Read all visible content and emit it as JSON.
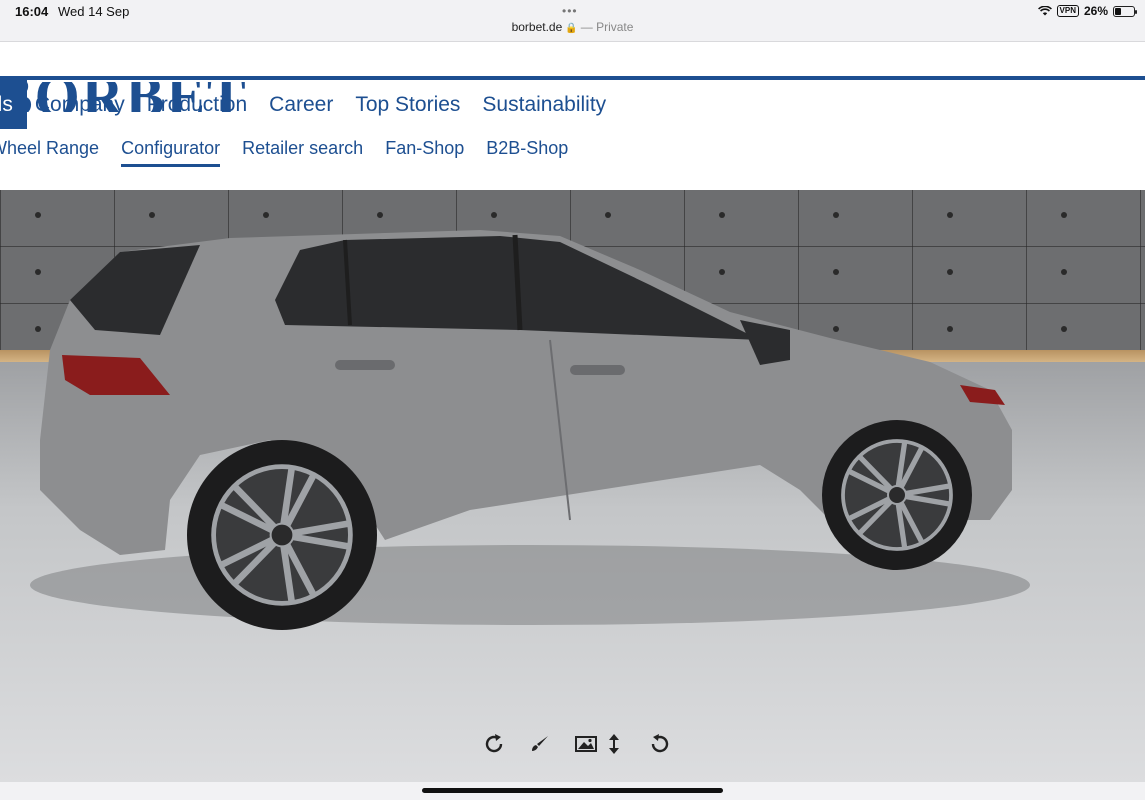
{
  "status": {
    "time": "16:04",
    "date": "Wed 14 Sep",
    "vpn": "VPN",
    "battery": "26%"
  },
  "browser": {
    "url": "borbet.de",
    "mode": "— Private"
  },
  "header": {
    "logo": "BORBET",
    "main_nav": [
      {
        "label": "Wheels",
        "visible_label": "els",
        "active": true
      },
      {
        "label": "Company"
      },
      {
        "label": "Production"
      },
      {
        "label": "Career"
      },
      {
        "label": "Top Stories"
      },
      {
        "label": "Sustainability"
      }
    ],
    "sub_nav": [
      {
        "label": "Wheel Range"
      },
      {
        "label": "Configurator",
        "active": true
      },
      {
        "label": "Retailer search"
      },
      {
        "label": "Fan-Shop"
      },
      {
        "label": "B2B-Shop"
      }
    ]
  },
  "configurator": {
    "car_color": "#8d8e90",
    "wheel_color": "#9fa2a6",
    "controls": [
      {
        "icon": "rotate-clockwise-icon"
      },
      {
        "icon": "paint-brush-icon"
      },
      {
        "icon": "background-image-icon"
      },
      {
        "icon": "height-adjust-icon"
      },
      {
        "icon": "reset-icon"
      }
    ]
  },
  "colors": {
    "brand": "#1d4f91"
  }
}
